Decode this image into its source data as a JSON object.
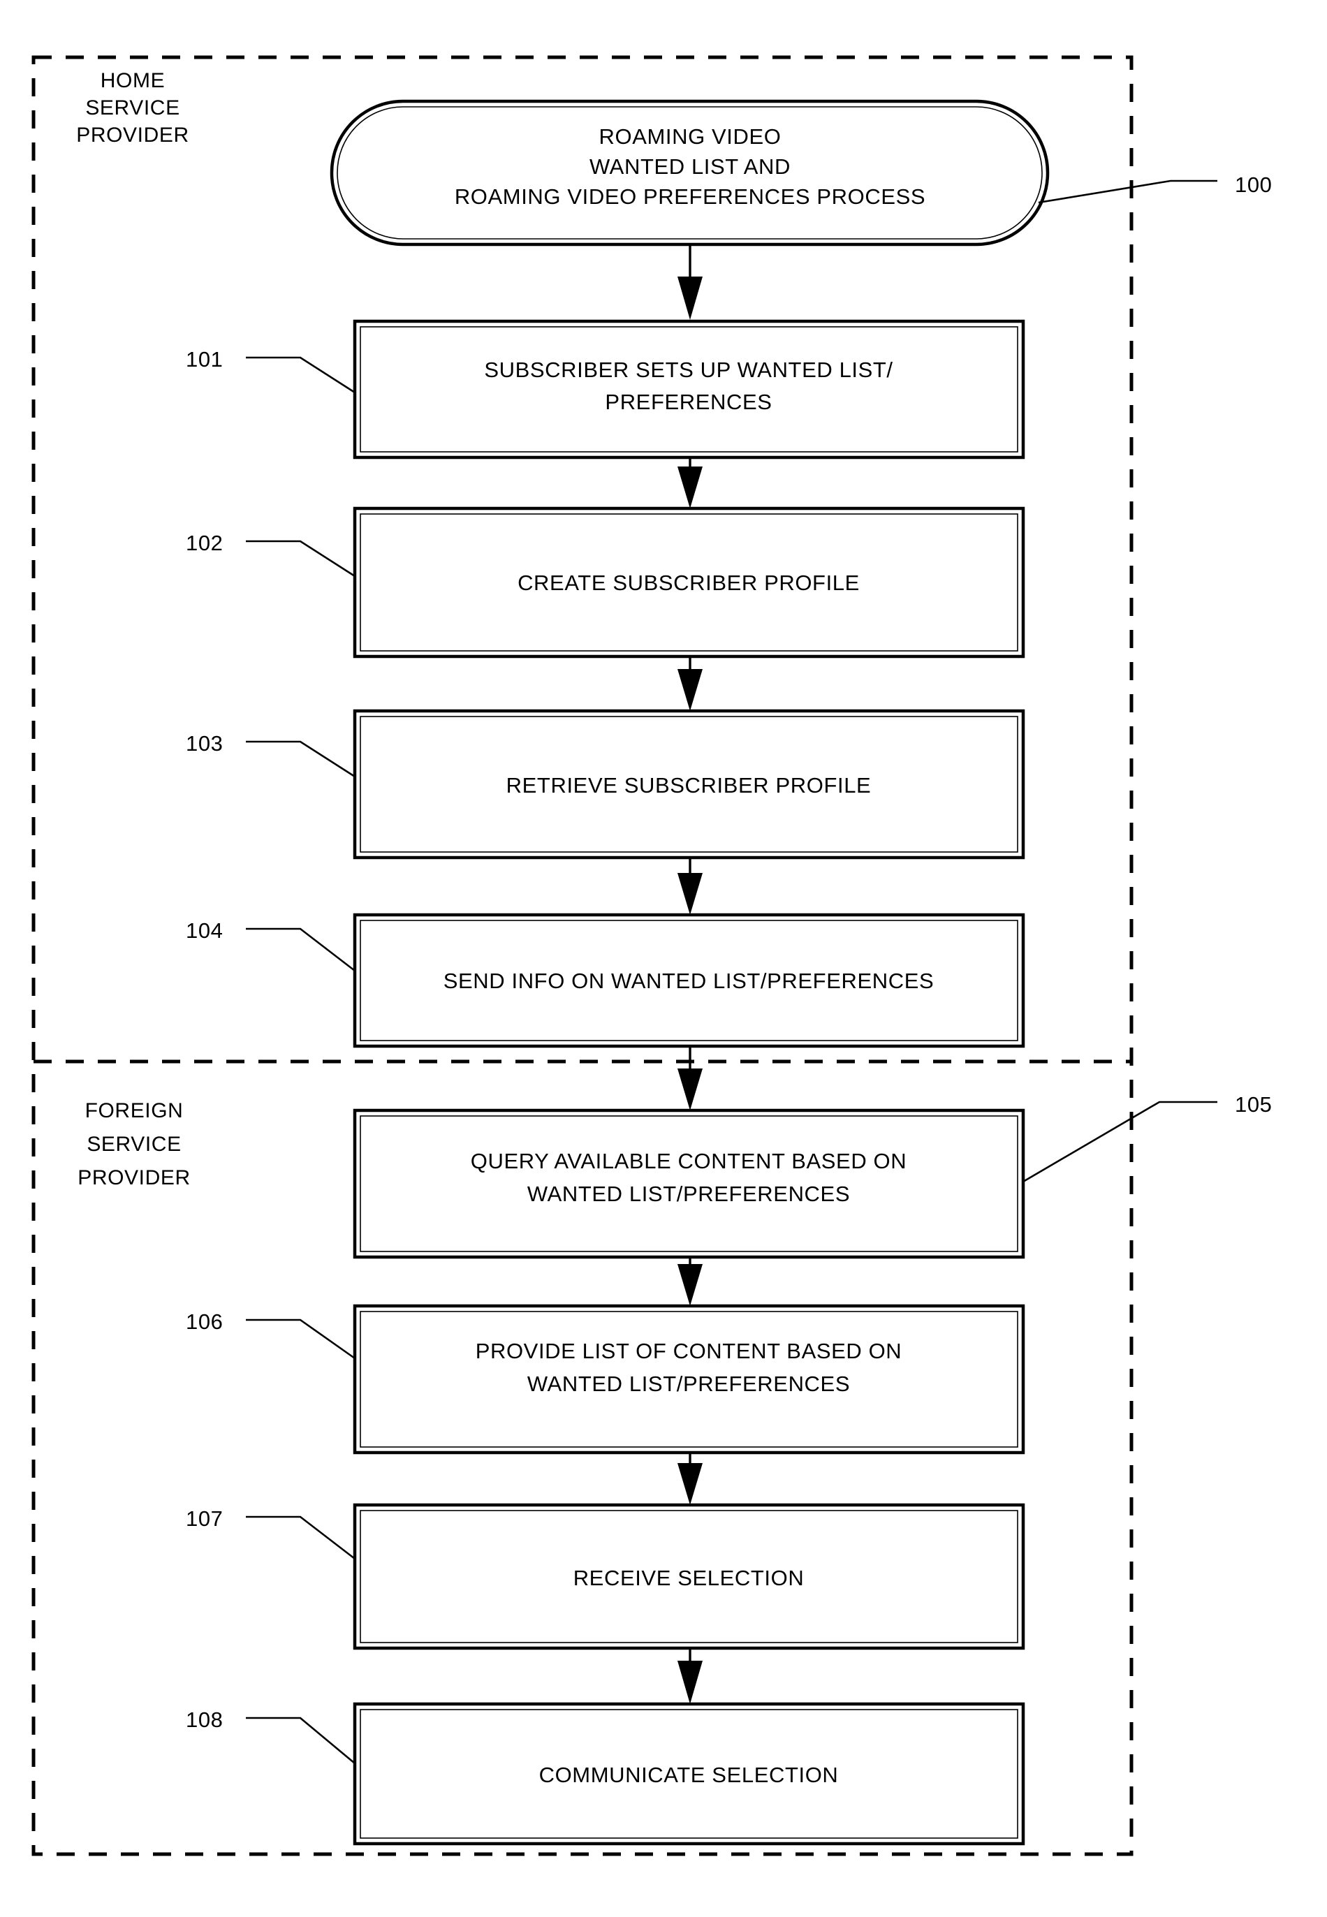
{
  "figure": {
    "type": "patent-flowchart",
    "title_ref": "100",
    "background_color": "#ffffff",
    "line_color": "#000000"
  },
  "swimlanes": [
    {
      "id": "home",
      "label": "HOME\nSERVICE\nPROVIDER",
      "lines": [
        "HOME",
        "SERVICE",
        "PROVIDER"
      ]
    },
    {
      "id": "foreign",
      "label": "FOREIGN\nSERVICE\nPROVIDER",
      "lines": [
        "FOREIGN",
        "SERVICE",
        "PROVIDER"
      ]
    }
  ],
  "terminator": {
    "ref": "100",
    "lines": [
      "ROAMING VIDEO",
      "WANTED LIST AND",
      "ROAMING VIDEO PREFERENCES PROCESS"
    ]
  },
  "steps": [
    {
      "ref": "101",
      "ref_side": "left",
      "lane": "home",
      "lines": [
        "SUBSCRIBER SETS UP WANTED LIST/",
        "PREFERENCES"
      ]
    },
    {
      "ref": "102",
      "ref_side": "left",
      "lane": "home",
      "lines": [
        "CREATE SUBSCRIBER PROFILE"
      ]
    },
    {
      "ref": "103",
      "ref_side": "left",
      "lane": "home",
      "lines": [
        "RETRIEVE SUBSCRIBER PROFILE"
      ]
    },
    {
      "ref": "104",
      "ref_side": "left",
      "lane": "home",
      "lines": [
        "SEND INFO ON WANTED LIST/PREFERENCES"
      ]
    },
    {
      "ref": "105",
      "ref_side": "right",
      "lane": "foreign",
      "lines": [
        "QUERY AVAILABLE CONTENT BASED ON",
        "WANTED LIST/PREFERENCES"
      ]
    },
    {
      "ref": "106",
      "ref_side": "left",
      "lane": "foreign",
      "lines": [
        "PROVIDE LIST OF CONTENT BASED ON",
        "WANTED LIST/PREFERENCES"
      ]
    },
    {
      "ref": "107",
      "ref_side": "left",
      "lane": "foreign",
      "lines": [
        "RECEIVE SELECTION"
      ]
    },
    {
      "ref": "108",
      "ref_side": "left",
      "lane": "foreign",
      "lines": [
        "COMMUNICATE SELECTION"
      ]
    }
  ]
}
